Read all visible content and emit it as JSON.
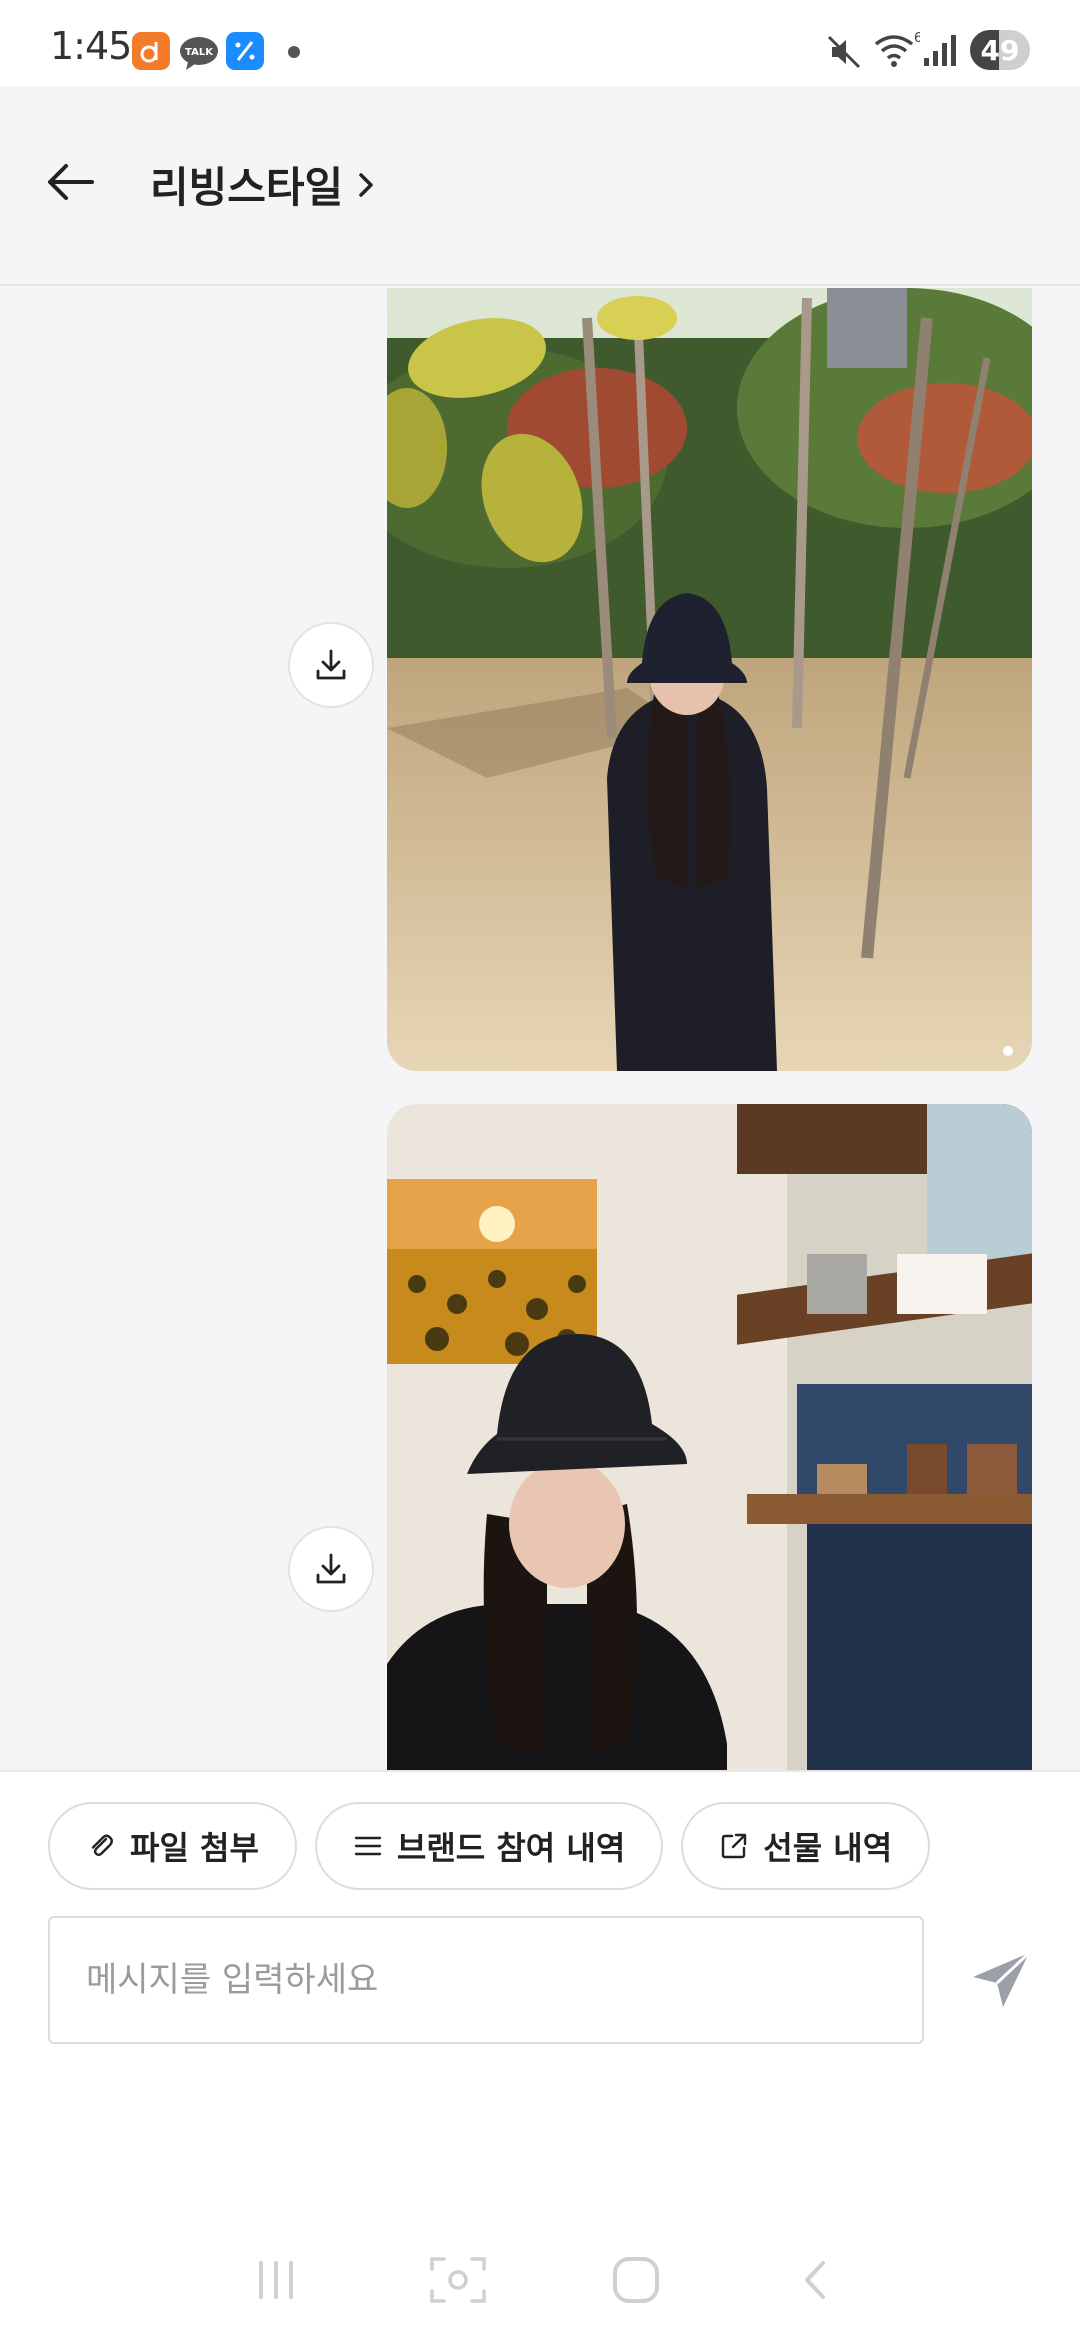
{
  "status_bar": {
    "time": "1:45",
    "battery": "49",
    "battery_level": 0.49,
    "icons": [
      "app-orange-icon",
      "talk-icon",
      "app-blue-icon",
      "notification-dot-icon",
      "mute-icon",
      "wifi-icon",
      "signal-icon",
      "battery-icon"
    ],
    "wifi_badge": "6"
  },
  "header": {
    "title": "리빙스타일",
    "back_icon": "arrow-left-icon",
    "title_chevron_icon": "chevron-right-icon"
  },
  "chat": {
    "messages": [
      {
        "type": "image",
        "name": "photo-woman-bucket-hat-outdoor"
      },
      {
        "type": "image",
        "name": "photo-woman-bucket-hat-cafe"
      }
    ],
    "download_icon": "download-icon"
  },
  "composer": {
    "chips": [
      {
        "label": "파일 첨부",
        "icon": "paperclip-icon"
      },
      {
        "label": "브랜드 참여 내역",
        "icon": "menu-lines-icon"
      },
      {
        "label": "선물 내역",
        "icon": "external-link-icon"
      }
    ],
    "input_placeholder": "메시지를 입력하세요",
    "input_value": "",
    "send_icon": "send-icon"
  },
  "navbar": {
    "buttons": [
      "recent-apps-icon",
      "screen-capture-icon",
      "home-icon",
      "back-icon"
    ]
  },
  "colors": {
    "background": "#f5f5f7",
    "accent_orange": "#f47b2a",
    "accent_blue": "#1a8cff",
    "send_icon": "#9a9fa8"
  }
}
